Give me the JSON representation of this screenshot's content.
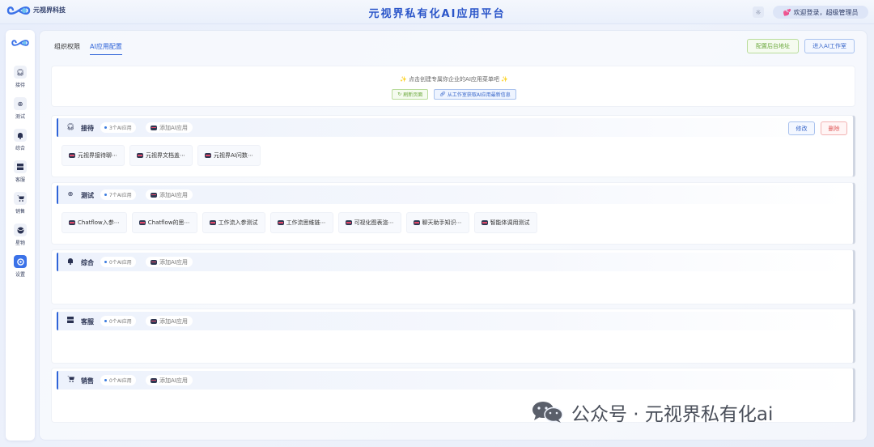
{
  "header": {
    "logo_name": "元视界科技",
    "logo_sub": "",
    "app_title": "元视界私有化AI应用平台",
    "welcome_text": "欢迎登录，超级管理员"
  },
  "sidebar": {
    "items": [
      {
        "label": "接待",
        "icon": "headset-icon"
      },
      {
        "label": "测试",
        "icon": "globe-icon"
      },
      {
        "label": "综合",
        "icon": "bell-icon"
      },
      {
        "label": "客服",
        "icon": "server-icon"
      },
      {
        "label": "销售",
        "icon": "cart-icon"
      },
      {
        "label": "星物",
        "icon": "planet-icon"
      },
      {
        "label": "设置",
        "icon": "settings-icon"
      }
    ],
    "active_index": 6
  },
  "main": {
    "tabs": [
      {
        "label": "组织权限"
      },
      {
        "label": "AI应用配置"
      }
    ],
    "active_tab": 1,
    "config_backend_label": "配置后台地址",
    "enter_workspace_label": "进入AI工作室"
  },
  "notice": {
    "text": "点击创建专属你企业的AI应用菜单吧",
    "refresh_label": "刷新页面",
    "fetch_label": "从工作室获取AI应用最新信息"
  },
  "sections": [
    {
      "title": "接待",
      "count": "3个AI应用",
      "add_label": "添加AI应用",
      "edit_label": "修改",
      "delete_label": "删除",
      "apps": [
        "元视界接待聊⋯",
        "元视界文档盖⋯",
        "元视界AI问数⋯"
      ]
    },
    {
      "title": "测试",
      "count": "7个AI应用",
      "add_label": "添加AI应用",
      "apps": [
        "Chatflow入参⋯",
        "Chatflow的思⋯",
        "工作流入参测试",
        "工作流思维链⋯",
        "可视化图表渲⋯",
        "聊天助手知识⋯",
        "智能体调用测试"
      ]
    },
    {
      "title": "综合",
      "count": "0个AI应用",
      "add_label": "添加AI应用",
      "apps": []
    },
    {
      "title": "客服",
      "count": "0个AI应用",
      "add_label": "添加AI应用",
      "apps": []
    },
    {
      "title": "销售",
      "count": "0个AI应用",
      "add_label": "添加AI应用",
      "apps": []
    }
  ],
  "watermark": {
    "text": "公众号 · 元视界私有化ai"
  },
  "colors": {
    "accent": "#2f64d8",
    "success": "#6aa83b",
    "danger": "#e05858"
  }
}
